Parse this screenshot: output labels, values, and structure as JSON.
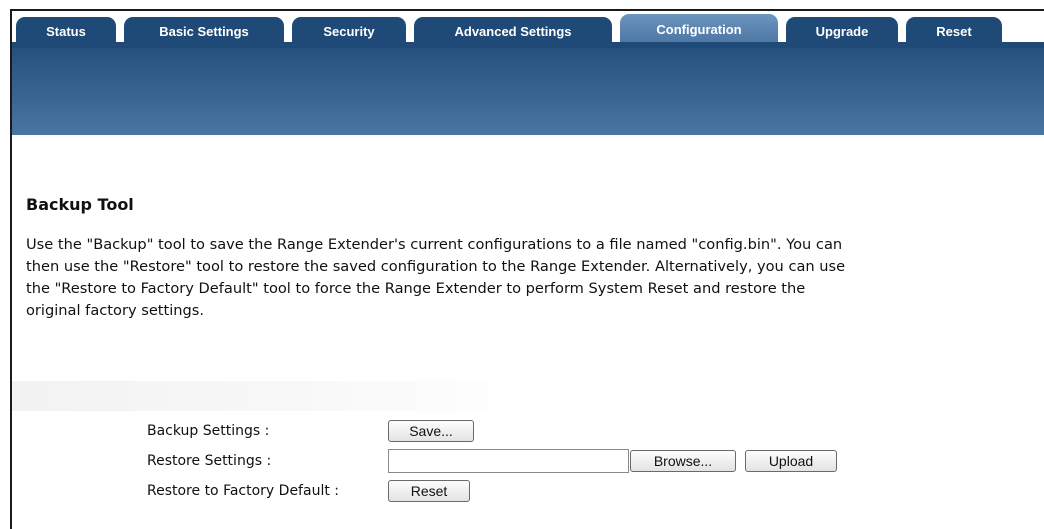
{
  "tabs": [
    {
      "label": "Status",
      "active": false
    },
    {
      "label": "Basic Settings",
      "active": false
    },
    {
      "label": "Security",
      "active": false
    },
    {
      "label": "Advanced Settings",
      "active": false
    },
    {
      "label": "Configuration",
      "active": true
    },
    {
      "label": "Upgrade",
      "active": false
    },
    {
      "label": "Reset",
      "active": false
    }
  ],
  "section": {
    "title": "Backup Tool",
    "description_lines": [
      "Use the \"Backup\" tool to save the Range Extender's current configurations to a file named \"config.bin\". You can",
      "then use the \"Restore\" tool to restore the saved configuration to the Range Extender. Alternatively, you can use",
      "the \"Restore to Factory Default\" tool to force the Range Extender to perform System Reset and restore the",
      "original factory settings."
    ]
  },
  "form": {
    "backup_label": "Backup Settings :",
    "save_button": "Save...",
    "restore_label": "Restore Settings :",
    "restore_file_value": "",
    "browse_button": "Browse...",
    "upload_button": "Upload",
    "factory_label": "Restore to Factory Default :",
    "reset_button": "Reset"
  },
  "colors": {
    "tab_bg": "#1f4a78",
    "tab_active_bg": "#5a84b1",
    "banner": "#3b6694"
  }
}
